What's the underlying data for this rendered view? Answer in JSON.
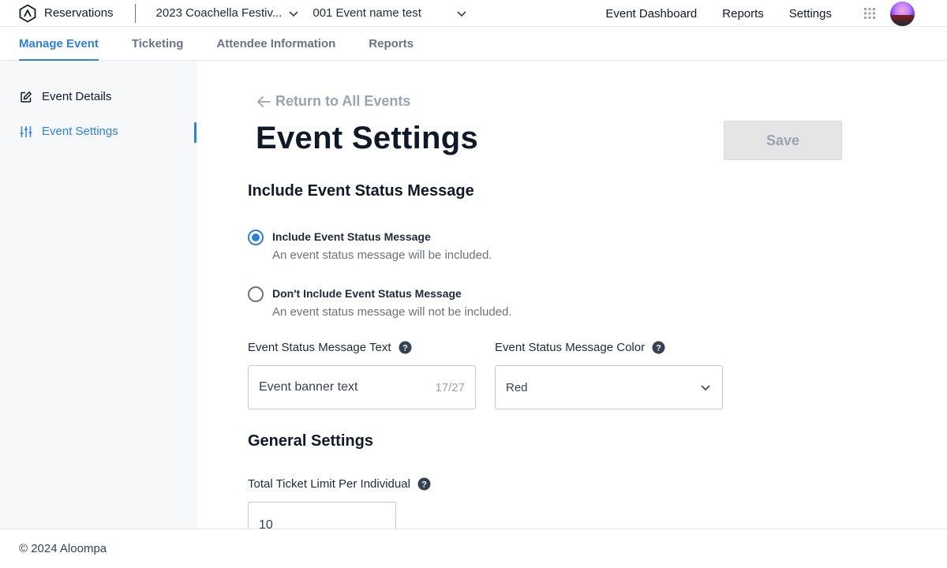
{
  "app": {
    "name": "Reservations",
    "logo_icon": "brand-logo-icon"
  },
  "selectors": {
    "festival": "2023 Coachella Festiv...",
    "event": "001 Event name test"
  },
  "topnav": {
    "dashboard": "Event Dashboard",
    "reports": "Reports",
    "settings": "Settings"
  },
  "tabs": [
    {
      "label": "Manage Event",
      "active": true
    },
    {
      "label": "Ticketing",
      "active": false
    },
    {
      "label": "Attendee Information",
      "active": false
    },
    {
      "label": "Reports",
      "active": false
    }
  ],
  "sidebar": {
    "items": [
      {
        "label": "Event Details",
        "icon": "edit-icon",
        "active": false
      },
      {
        "label": "Event Settings",
        "icon": "sliders-icon",
        "active": true
      }
    ]
  },
  "main": {
    "back_label": "Return to All Events",
    "title": "Event Settings",
    "save_label": "Save",
    "status_section": {
      "title": "Include Event Status Message",
      "options": [
        {
          "label": "Include Event Status Message",
          "desc": "An event status message will be included.",
          "selected": true
        },
        {
          "label": "Don't Include Event Status Message",
          "desc": "An event status message will not be included.",
          "selected": false
        }
      ],
      "text_label": "Event Status Message Text",
      "text_value": "Event banner text",
      "text_count": "17/27",
      "color_label": "Event Status Message Color",
      "color_value": "Red"
    },
    "general_section": {
      "title": "General Settings",
      "limit_label": "Total Ticket Limit Per Individual",
      "limit_value": "10"
    }
  },
  "footer": {
    "copyright": "© 2024 Aloompa"
  },
  "colors": {
    "accent": "#2f80d8",
    "sidebar_bg": "#f7f8fa",
    "disabled_button": "#e5e5e5"
  }
}
